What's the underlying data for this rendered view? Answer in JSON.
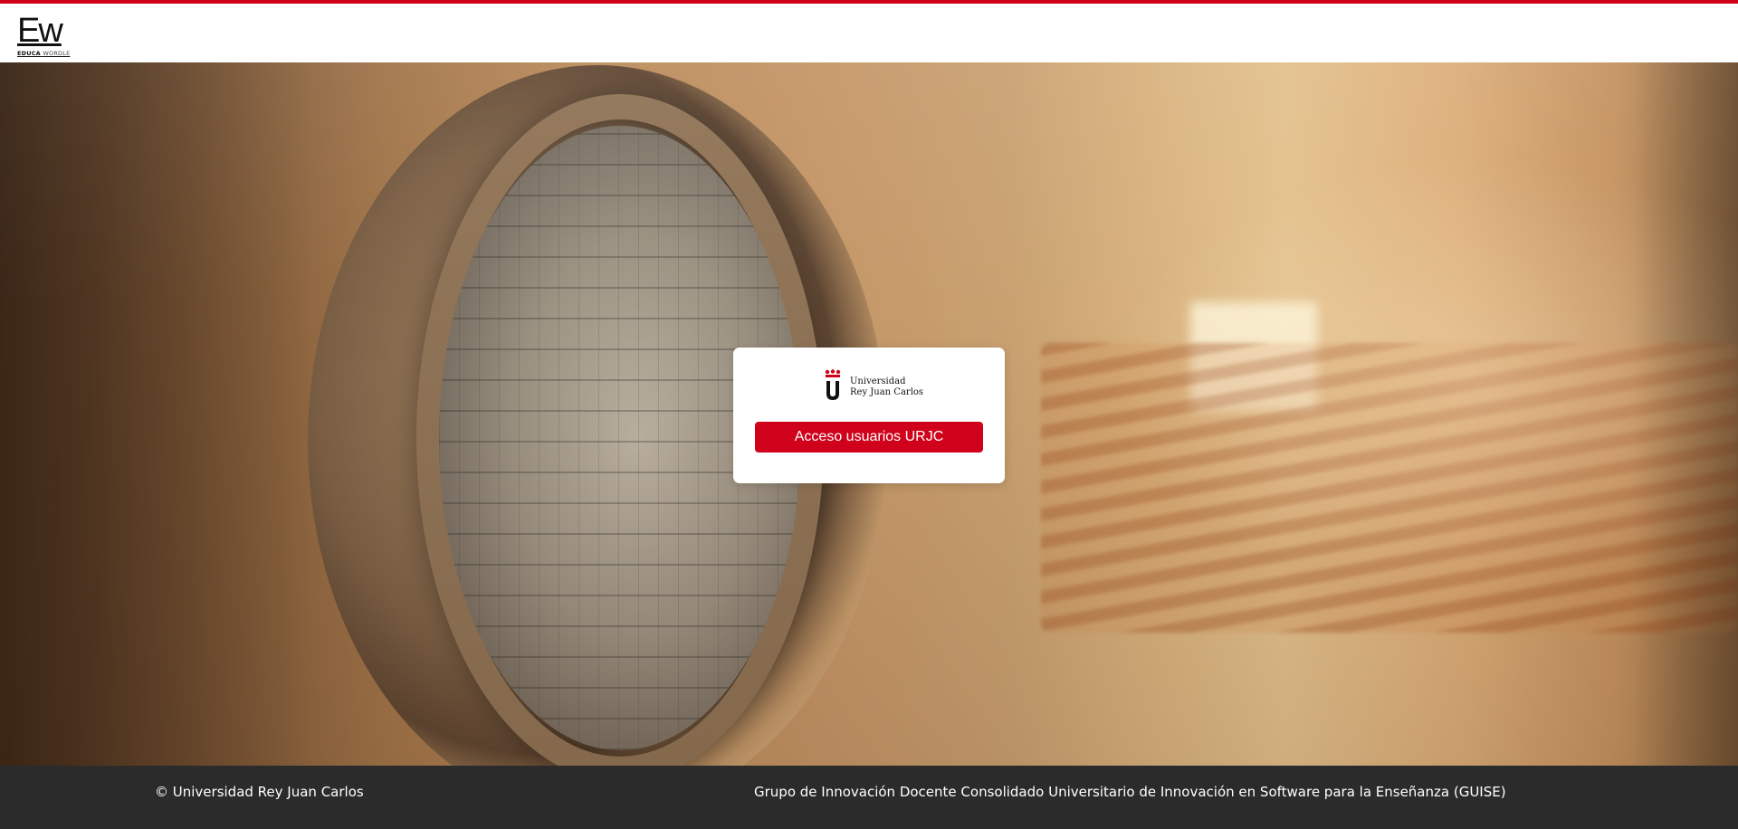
{
  "header": {
    "logo_mark": "Ew",
    "logo_sub_bold": "EDUCA",
    "logo_sub_light": "WORDLE"
  },
  "login_card": {
    "university_line1": "Universidad",
    "university_line2": "Rey Juan Carlos",
    "login_button_label": "Acceso usuarios URJC"
  },
  "footer": {
    "copyright": "© Universidad Rey Juan Carlos",
    "group": "Grupo de Innovación Docente Consolidado Universitario de Innovación en Software para la Enseñanza (GUISE)"
  },
  "colors": {
    "accent": "#d0021b",
    "footer_bg": "#2b2b2c",
    "header_bg": "#ffffff"
  },
  "icons": {
    "urjc_logo": "urjc-crown-u-logo",
    "app_logo": "educa-wordle-logo"
  }
}
